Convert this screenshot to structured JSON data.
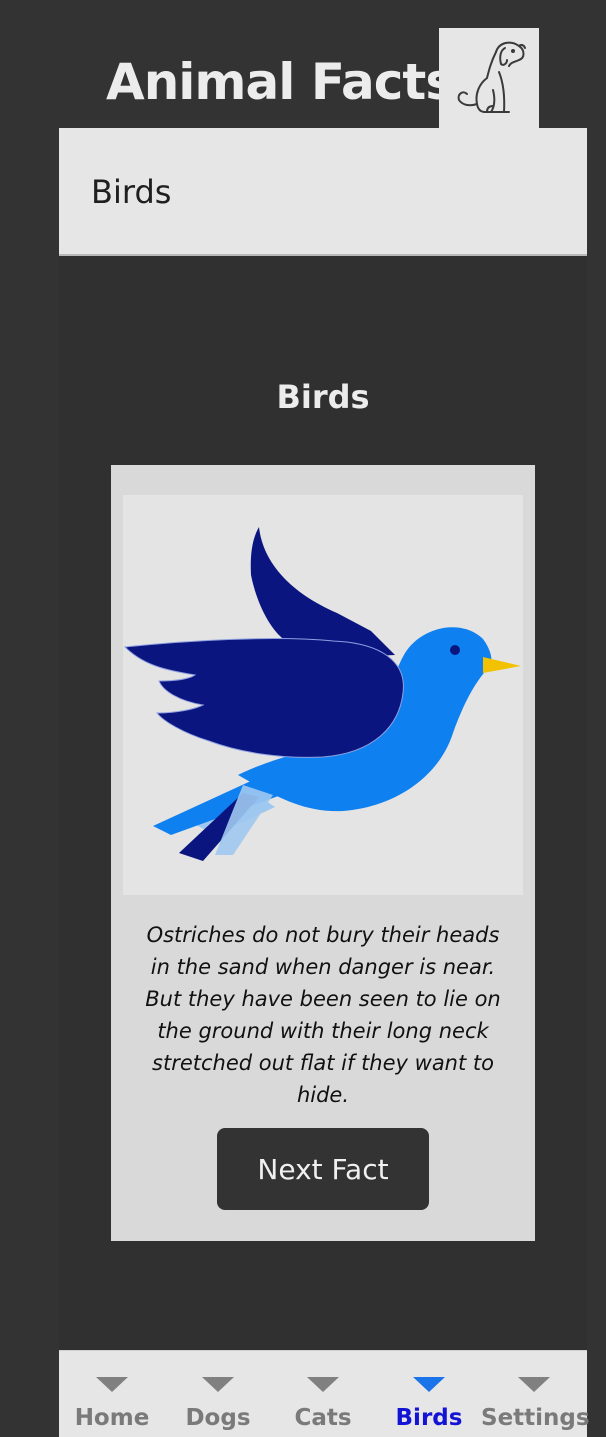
{
  "app": {
    "title": "Animal Facts",
    "logo_icon": "dog-icon"
  },
  "header": {
    "title": "Birds"
  },
  "section": {
    "heading": "Birds"
  },
  "card": {
    "image_icon": "bluebird-illustration",
    "fact": "Ostriches do not bury their heads in the sand when danger is near. But they have been seen to lie on the ground with their long neck stretched out flat if they want to hide.",
    "next_button_label": "Next Fact"
  },
  "nav": {
    "items": [
      {
        "label": "Home",
        "icon": "chevron-down-icon",
        "active": false
      },
      {
        "label": "Dogs",
        "icon": "chevron-down-icon",
        "active": false
      },
      {
        "label": "Cats",
        "icon": "chevron-down-icon",
        "active": false
      },
      {
        "label": "Birds",
        "icon": "chevron-down-icon",
        "active": true
      },
      {
        "label": "Settings",
        "icon": "chevron-down-icon",
        "active": false
      }
    ]
  },
  "colors": {
    "background": "#333333",
    "surface": "#e6e6e6",
    "card": "#d9d9d9",
    "active_nav": "#1313d6",
    "active_indicator": "#1a73e8",
    "bird_dark": "#0a1580",
    "bird_light": "#0f80f0",
    "beak": "#f2c200"
  }
}
